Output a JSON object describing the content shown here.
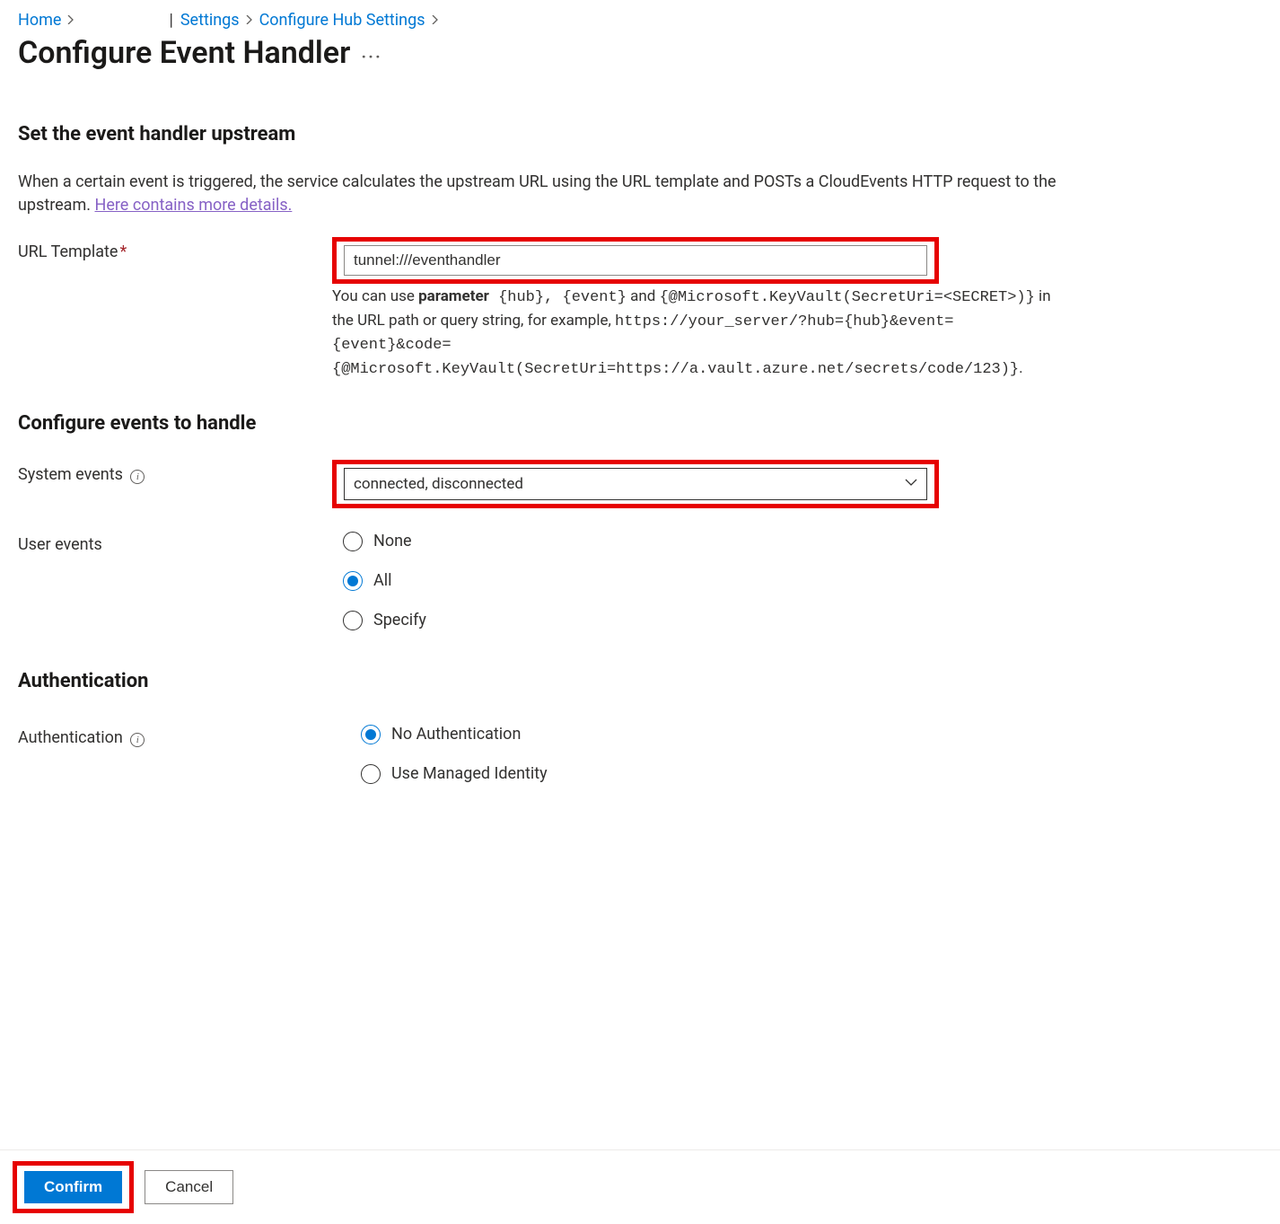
{
  "breadcrumb": {
    "home": "Home",
    "settings": "Settings",
    "configure_hub": "Configure Hub Settings"
  },
  "page": {
    "title": "Configure Event Handler"
  },
  "upstream": {
    "heading": "Set the event handler upstream",
    "desc_prefix": "When a certain event is triggered, the service calculates the upstream URL using the URL template and POSTs a CloudEvents HTTP request to the upstream. ",
    "desc_link": "Here contains more details.",
    "url_template_label": "URL Template",
    "url_template_value": "tunnel:///eventhandler",
    "hint_pre": "You can use ",
    "hint_parameter_word": "parameter",
    "hint_params": " {hub}, {event}",
    "hint_and": " and ",
    "hint_kv": "{@Microsoft.KeyVault(SecretUri=<SECRET>)}",
    "hint_mid": " in the URL path or query string, for example, ",
    "hint_example": "https://your_server/?hub={hub}&event={event}&code={@Microsoft.KeyVault(SecretUri=https://a.vault.azure.net/secrets/code/123)}",
    "hint_end": "."
  },
  "events": {
    "heading": "Configure events to handle",
    "system_label": "System events",
    "system_value": "connected, disconnected",
    "user_label": "User events",
    "user_options": {
      "none": "None",
      "all": "All",
      "specify": "Specify"
    },
    "user_selected": "all"
  },
  "auth": {
    "heading": "Authentication",
    "label": "Authentication",
    "options": {
      "none": "No Authentication",
      "managed": "Use Managed Identity"
    },
    "selected": "none"
  },
  "footer": {
    "confirm": "Confirm",
    "cancel": "Cancel"
  }
}
